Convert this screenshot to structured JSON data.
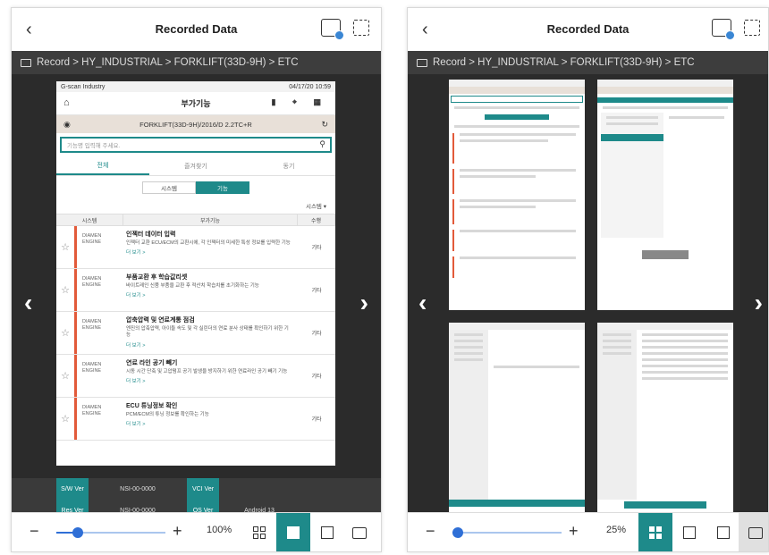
{
  "left": {
    "header": {
      "title": "Recorded Data"
    },
    "breadcrumb": "Record > HY_INDUSTRIAL > FORKLIFT(33D-9H) > ETC",
    "screen": {
      "status_left": "G-scan Industry",
      "status_right": "04/17/20 10:59",
      "app_title": "부가기능",
      "vehicle": "FORKLIFT(33D-9H)/2016/D 2.2TC+R",
      "search_placeholder": "기능명 입력해 주세요.",
      "tabs": [
        "전체",
        "즐겨찾기",
        "동기"
      ],
      "segments": [
        "시스템",
        "기능"
      ],
      "filter": "시스템",
      "columns": [
        "시스템",
        "부가기능",
        "수행"
      ],
      "rows": [
        {
          "sys": "DIAMEN ENGINE",
          "title": "인젝터 데이터 입력",
          "desc": "인젝터 교환 ECU/ECM의 교환시에, 각 인젝터의 미세한 특성 정보를 입력한 기능",
          "more": "더 보기 >",
          "action": "기타"
        },
        {
          "sys": "DIAMEN ENGINE",
          "title": "부품교환 후 학습값리셋",
          "desc": "바이트레인 신품 부품을 교환 후 적산치 학습치를 초기화하는 기능",
          "more": "더 보기 >",
          "action": "기타"
        },
        {
          "sys": "DIAMEN ENGINE",
          "title": "압축압력 및 연료계통 점검",
          "desc": "엔진의 압축압력, 아이들 속도 및 각 실린더의 연료 분사 상태를 확인하기 위한 기능",
          "more": "더 보기 >",
          "action": "기타"
        },
        {
          "sys": "DIAMEN ENGINE",
          "title": "연료 라인 공기 빼기",
          "desc": "시동 시간 단축 및 고압펌프 공기 발생을 방지하기 위한 연료라인 공기 빼기 기능",
          "more": "더 보기 >",
          "action": "기타"
        },
        {
          "sys": "DIAMEN ENGINE",
          "title": "ECU 튜닝정보 확인",
          "desc": "PCM/ECM의 튜닝 정보를 확인하는 기능",
          "more": "더 보기 >",
          "action": "기타"
        }
      ],
      "ver_rows": [
        {
          "l1": "S/W Ver",
          "v1": "NSI-00-0000",
          "l2": "VCI Ver",
          "v2": ""
        },
        {
          "l1": "Res Ver",
          "v1": "NSI-00-0000",
          "l2": "OS Ver",
          "v2": "Android 13"
        }
      ]
    },
    "zoom": {
      "label": "100%",
      "level": 0.2
    }
  },
  "right": {
    "header": {
      "title": "Recorded Data"
    },
    "breadcrumb": "Record > HY_INDUSTRIAL > FORKLIFT(33D-9H) > ETC",
    "zoom": {
      "label": "25%",
      "level": 0.05
    }
  }
}
